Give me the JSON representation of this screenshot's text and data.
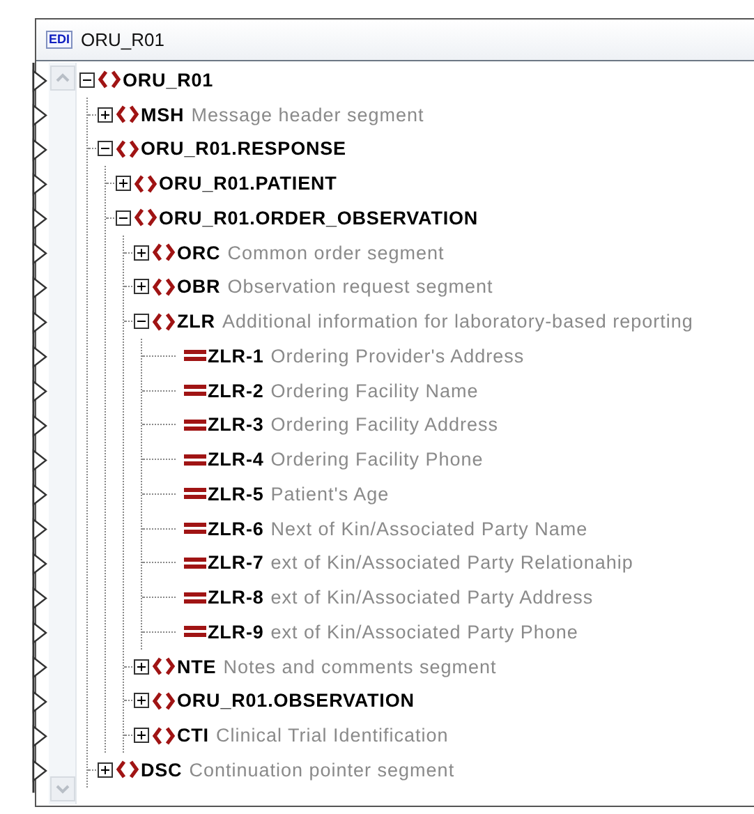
{
  "window": {
    "icon_label": "EDI",
    "title": "ORU_R01"
  },
  "tree": [
    {
      "kind": "group",
      "name": "ORU_R01",
      "expanded": true,
      "children": [
        {
          "kind": "group",
          "name": "MSH",
          "description": "Message header segment",
          "expanded": false
        },
        {
          "kind": "group",
          "name": "ORU_R01.RESPONSE",
          "expanded": true,
          "children": [
            {
              "kind": "group",
              "name": "ORU_R01.PATIENT",
              "expanded": false
            },
            {
              "kind": "group",
              "name": "ORU_R01.ORDER_OBSERVATION",
              "expanded": true,
              "children": [
                {
                  "kind": "group",
                  "name": "ORC",
                  "description": "Common order segment",
                  "expanded": false
                },
                {
                  "kind": "group",
                  "name": "OBR",
                  "description": "Observation request segment",
                  "expanded": false
                },
                {
                  "kind": "group",
                  "name": "ZLR",
                  "description": "Additional information for laboratory-based reporting",
                  "expanded": true,
                  "children": [
                    {
                      "kind": "field",
                      "name": "ZLR-1",
                      "description": "Ordering Provider's Address"
                    },
                    {
                      "kind": "field",
                      "name": "ZLR-2",
                      "description": "Ordering Facility Name"
                    },
                    {
                      "kind": "field",
                      "name": "ZLR-3",
                      "description": "Ordering Facility Address"
                    },
                    {
                      "kind": "field",
                      "name": "ZLR-4",
                      "description": "Ordering Facility Phone"
                    },
                    {
                      "kind": "field",
                      "name": "ZLR-5",
                      "description": "Patient's Age"
                    },
                    {
                      "kind": "field",
                      "name": "ZLR-6",
                      "description": "Next of Kin/Associated Party Name"
                    },
                    {
                      "kind": "field",
                      "name": "ZLR-7",
                      "description": "ext of Kin/Associated Party Relationahip"
                    },
                    {
                      "kind": "field",
                      "name": "ZLR-8",
                      "description": "ext of Kin/Associated Party Address"
                    },
                    {
                      "kind": "field",
                      "name": "ZLR-9",
                      "description": "ext of Kin/Associated Party Phone"
                    }
                  ]
                },
                {
                  "kind": "group",
                  "name": "NTE",
                  "description": "Notes and comments segment",
                  "expanded": false
                },
                {
                  "kind": "group",
                  "name": "ORU_R01.OBSERVATION",
                  "expanded": false
                },
                {
                  "kind": "group",
                  "name": "CTI",
                  "description": "Clinical Trial Identification",
                  "expanded": false
                }
              ]
            }
          ]
        },
        {
          "kind": "group",
          "name": "DSC",
          "description": "Continuation pointer segment",
          "expanded": false
        }
      ]
    }
  ]
}
